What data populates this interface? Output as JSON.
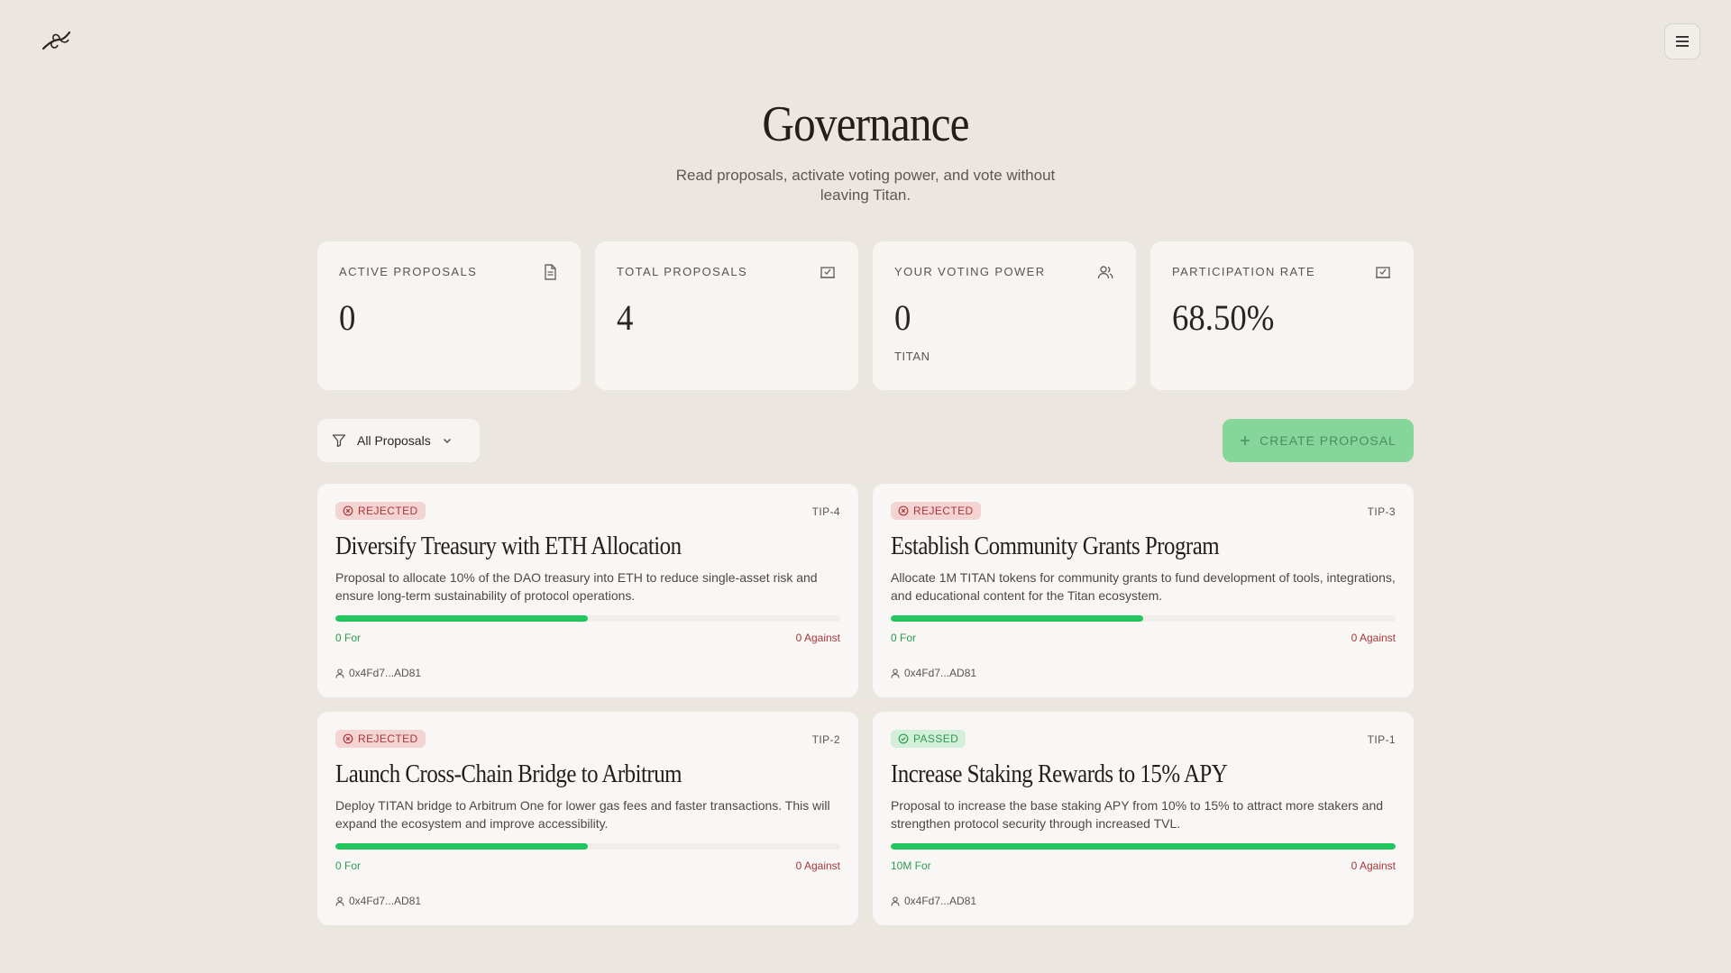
{
  "header": {
    "logo_icon": "dragonfly-logo-icon",
    "menu_icon": "hamburger-menu-icon"
  },
  "hero": {
    "title": "Governance",
    "subtitle": "Read proposals, activate voting power, and vote without leaving Titan."
  },
  "stats": [
    {
      "label": "ACTIVE PROPOSALS",
      "value": "0",
      "unit": "",
      "icon": "document-icon"
    },
    {
      "label": "TOTAL PROPOSALS",
      "value": "4",
      "unit": "",
      "icon": "vote-box-icon"
    },
    {
      "label": "YOUR VOTING POWER",
      "value": "0",
      "unit": "TITAN",
      "icon": "users-icon"
    },
    {
      "label": "PARTICIPATION RATE",
      "value": "68.50%",
      "unit": "",
      "icon": "vote-box-icon"
    }
  ],
  "toolbar": {
    "filter_label": "All Proposals",
    "create_label": "CREATE PROPOSAL"
  },
  "proposals": [
    {
      "status": "REJECTED",
      "status_type": "rejected",
      "id": "TIP-4",
      "title": "Diversify Treasury with ETH Allocation",
      "description": "Proposal to allocate 10% of the DAO treasury into ETH to reduce single-asset risk and ensure long-term sustainability of protocol operations.",
      "for_label": "0 For",
      "against_label": "0 Against",
      "for_fraction": 0.5,
      "author": "0x4Fd7...AD81"
    },
    {
      "status": "REJECTED",
      "status_type": "rejected",
      "id": "TIP-3",
      "title": "Establish Community Grants Program",
      "description": "Allocate 1M TITAN tokens for community grants to fund development of tools, integrations, and educational content for the Titan ecosystem.",
      "for_label": "0 For",
      "against_label": "0 Against",
      "for_fraction": 0.5,
      "author": "0x4Fd7...AD81"
    },
    {
      "status": "REJECTED",
      "status_type": "rejected",
      "id": "TIP-2",
      "title": "Launch Cross-Chain Bridge to Arbitrum",
      "description": "Deploy TITAN bridge to Arbitrum One for lower gas fees and faster transactions. This will expand the ecosystem and improve accessibility.",
      "for_label": "0 For",
      "against_label": "0 Against",
      "for_fraction": 0.5,
      "author": "0x4Fd7...AD81"
    },
    {
      "status": "PASSED",
      "status_type": "passed",
      "id": "TIP-1",
      "title": "Increase Staking Rewards to 15% APY",
      "description": "Proposal to increase the base staking APY from 10% to 15% to attract more stakers and strengthen protocol security through increased TVL.",
      "for_label": "10M For",
      "against_label": "0 Against",
      "for_fraction": 1.0,
      "author": "0x4Fd7...AD81"
    }
  ],
  "colors": {
    "background": "#ebe6df",
    "card": "#f8f7f5",
    "accent_green": "#22c55e",
    "rejected": "#a8373a",
    "passed": "#2e9a50"
  }
}
